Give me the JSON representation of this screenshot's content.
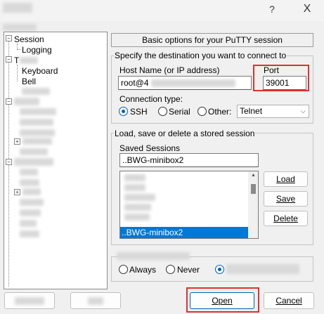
{
  "titlebar": {
    "help": "?",
    "close": "X"
  },
  "tree": {
    "items": [
      "Session",
      "Logging",
      "T",
      "Keyboard",
      "Bell"
    ]
  },
  "header": "Basic options for your PuTTY session",
  "destination": {
    "label": "Specify the destination you want to connect to",
    "host_label": "Host Name (or IP address)",
    "host_value": "root@4",
    "port_label": "Port",
    "port_value": "39001"
  },
  "conntype": {
    "label": "Connection type:",
    "ssh": "SSH",
    "serial": "Serial",
    "other": "Other:",
    "other_select": "Telnet"
  },
  "sessions": {
    "group_label": "Load, save or delete a stored session",
    "saved_label": "Saved Sessions",
    "saved_value": "..BWG-minibox2",
    "selected_item": "..BWG-minibox2",
    "load": "Load",
    "save": "Save",
    "delete": "Delete"
  },
  "close_on_exit": {
    "always": "Always",
    "never": "Never"
  },
  "footer": {
    "open": "Open",
    "cancel": "Cancel"
  },
  "colors": {
    "accent": "#0078d7",
    "highlight": "#e03030"
  }
}
